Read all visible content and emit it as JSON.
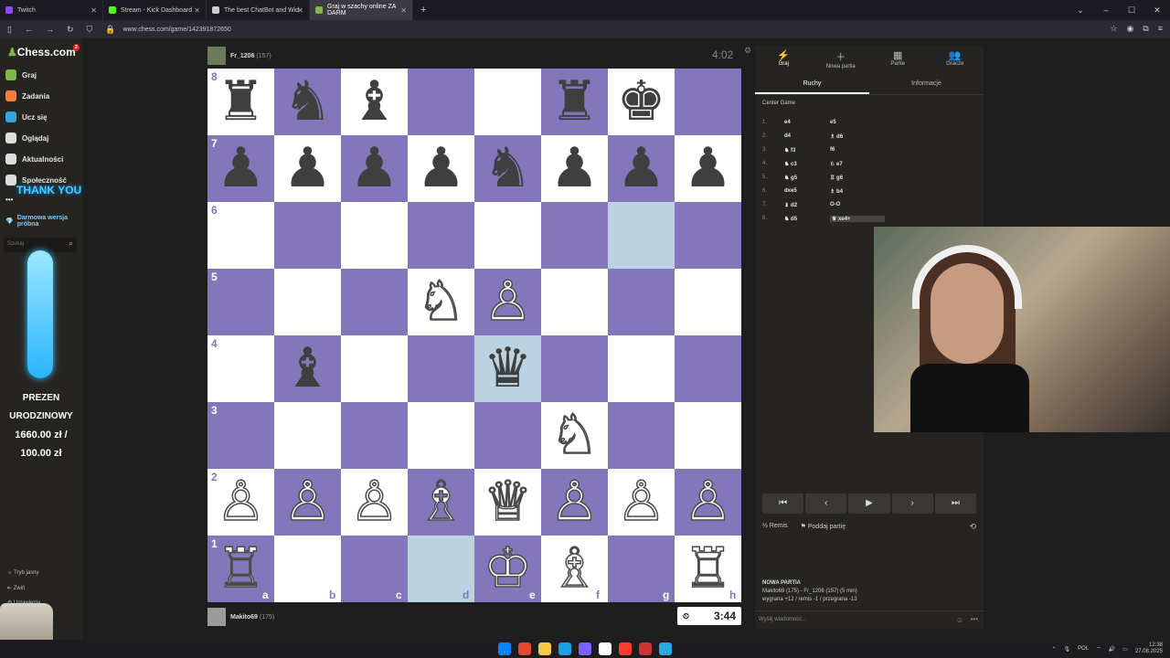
{
  "browser": {
    "tabs": [
      {
        "title": "Twitch",
        "color": "#9146ff"
      },
      {
        "title": "Stream - Kick Dashboard",
        "color": "#53fc18"
      },
      {
        "title": "The best ChatBot and Wid",
        "color": "#cccccc"
      },
      {
        "title": "Graj w szachy online ZA DARM",
        "color": "#81b64c"
      }
    ],
    "active_tab": 3,
    "new_tab": "+",
    "url": "www.chess.com/game/142391872650"
  },
  "sidebar": {
    "logo": "Chess.com",
    "badge": "2",
    "items": [
      {
        "label": "Graj",
        "color": "#81b64c"
      },
      {
        "label": "Zadania",
        "color": "#f5803e"
      },
      {
        "label": "Ucz się",
        "color": "#36a5e0"
      },
      {
        "label": "Oglądaj",
        "color": "#dddddd"
      },
      {
        "label": "Aktualności",
        "color": "#dddddd"
      },
      {
        "label": "Społeczność",
        "color": "#dddddd"
      }
    ],
    "more": "•••",
    "trial": "Darmowa wersja próbna",
    "search_placeholder": "Szukaj",
    "bottom": [
      "Tryb jasny",
      "Zwiń",
      "Ustawienia"
    ]
  },
  "overlay": {
    "thanks": "THANK YOU",
    "prize_lines": [
      "PREZEN",
      "URODZINOWY",
      "1660.00 zł /",
      "100.00 zł"
    ]
  },
  "game": {
    "top_player": {
      "name": "Fr_1206",
      "rating": "(157)"
    },
    "bottom_player": {
      "name": "Makito69",
      "rating": "(175)"
    },
    "top_clock": "4:02",
    "bottom_clock": "3:44",
    "ranks": [
      "8",
      "7",
      "6",
      "5",
      "4",
      "3",
      "2",
      "1"
    ],
    "files": [
      "a",
      "b",
      "c",
      "d",
      "e",
      "f",
      "g",
      "h"
    ],
    "highlight": [
      "g6",
      "e4",
      "d1"
    ],
    "pieces": {
      "a8": "♜b",
      "b8": "♞b",
      "c8": "♝b",
      "f8": "♜b",
      "g8": "♚b",
      "a7": "♟b",
      "b7": "♟b",
      "c7": "♟b",
      "d7": "♟b",
      "e7": "♞b",
      "f7": "♟b",
      "g7": "♟b",
      "h7": "♟b",
      "d5": "♘w",
      "e5": "♙w",
      "b4": "♝b",
      "e4": "♛b",
      "f3": "♘w",
      "a2": "♙w",
      "b2": "♙w",
      "c2": "♙w",
      "d2": "♗w",
      "e2": "♕w",
      "f2": "♙w",
      "g2": "♙w",
      "h2": "♙w",
      "a1": "♖w",
      "e1": "♔w",
      "f1": "♗w",
      "h1": "♖w"
    }
  },
  "panel": {
    "top_tabs": [
      {
        "label": "Graj",
        "icon": "⚡"
      },
      {
        "label": "Nowa partia",
        "icon": "＋"
      },
      {
        "label": "Partie",
        "icon": "▦"
      },
      {
        "label": "Gracze",
        "icon": "👥"
      }
    ],
    "sub_tabs": [
      "Ruchy",
      "Informacje"
    ],
    "opening": "Center Game",
    "moves": [
      {
        "n": "1.",
        "w": "e4",
        "b": "e5"
      },
      {
        "n": "2.",
        "w": "d4",
        "b": "♗ d6"
      },
      {
        "n": "3.",
        "w": "♞ f3",
        "b": "f6"
      },
      {
        "n": "4.",
        "w": "♞ c3",
        "b": "♘ e7"
      },
      {
        "n": "5.",
        "w": "♞ g5",
        "b": "♖ g6"
      },
      {
        "n": "6.",
        "w": "dxe5",
        "b": "♗ b4"
      },
      {
        "n": "7.",
        "w": "♝ d2",
        "b": "O-O"
      },
      {
        "n": "8.",
        "w": "♞ d5",
        "b": "♕ xe4+"
      }
    ],
    "controls": [
      "⏮",
      "‹",
      "▶",
      "›",
      "⏭"
    ],
    "draw": "½ Remis",
    "resign": "Poddaj partię",
    "new_game_title": "NOWA PARTIA",
    "new_game_line1": "Makito69 (175) - Fr_1206 (157) (5 min)",
    "new_game_line2": "wygrana +12 / remis -1 / przegrana -13",
    "chat_placeholder": "Wyślij wiadomość..."
  },
  "taskbar": {
    "icon_colors": [
      "#0a84ff",
      "#e5492d",
      "#f7c948",
      "#1aa0e6",
      "#7b61ff",
      "#ffffff",
      "#ff3b30",
      "#cc3333",
      "#2aa9e0"
    ],
    "lang": "POL",
    "time": "12:38",
    "date": "27.08.2025"
  }
}
